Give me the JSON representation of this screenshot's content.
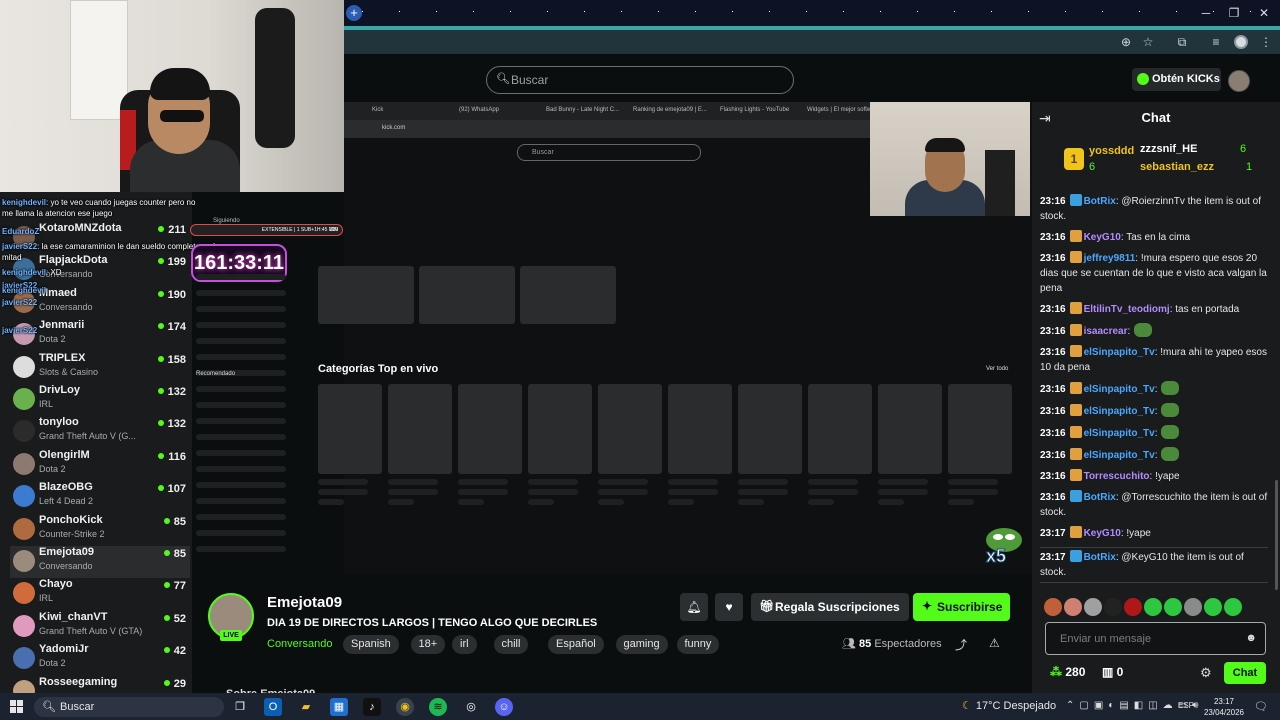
{
  "colors": {
    "accent": "#53fc18",
    "bg": "#0b0e0f",
    "panel": "#191b1c"
  },
  "header": {
    "search_placeholder": "Buscar",
    "kicks_label": "Obtén KICKs"
  },
  "sidebar": {
    "items": [
      {
        "name": "KotaroMNZdota",
        "sub": "",
        "viewers": "211"
      },
      {
        "name": "FlapjackDota",
        "sub": "Conversando",
        "viewers": "199"
      },
      {
        "name": "Mmaed",
        "sub": "Conversando",
        "viewers": "190"
      },
      {
        "name": "Jenmarii",
        "sub": "Dota 2",
        "viewers": "174"
      },
      {
        "name": "TRIPLEX",
        "sub": "Slots & Casino",
        "viewers": "158"
      },
      {
        "name": "DrivLoy",
        "sub": "IRL",
        "viewers": "132"
      },
      {
        "name": "tonyloo",
        "sub": "Grand Theft Auto V (G...",
        "viewers": "132"
      },
      {
        "name": "OlengirlM",
        "sub": "Dota 2",
        "viewers": "116"
      },
      {
        "name": "BlazeOBG",
        "sub": "Left 4 Dead 2",
        "viewers": "107"
      },
      {
        "name": "PonchoKick",
        "sub": "Counter-Strike 2",
        "viewers": "85"
      },
      {
        "name": "Emejota09",
        "sub": "Conversando",
        "viewers": "85"
      },
      {
        "name": "Chayo",
        "sub": "IRL",
        "viewers": "77"
      },
      {
        "name": "Kiwi_chanVT",
        "sub": "Grand Theft Auto V (GTA)",
        "viewers": "52"
      },
      {
        "name": "YadomiJr",
        "sub": "Dota 2",
        "viewers": "42"
      },
      {
        "name": "Rosseegaming",
        "sub": "",
        "viewers": "29"
      }
    ]
  },
  "overlay_chat": [
    {
      "user": "kenighdevil",
      "text": ": yo te veo cuando juegas counter pero no"
    },
    {
      "user": "",
      "text": "me llama la atencion ese juego"
    },
    {
      "user": "EduardoZ",
      "text": ""
    },
    {
      "user": "javierS22",
      "text": ": la ese camaraminion le dan sueldo completo pa la"
    },
    {
      "user": "",
      "text": "mitad"
    },
    {
      "user": "kenighdevil",
      "text": ": XD"
    },
    {
      "user": "javierS22",
      "text": ""
    },
    {
      "user": "kenighdevil",
      "text": ""
    },
    {
      "user": "javierS22",
      "text": ""
    },
    {
      "user": "javierS22",
      "text": ""
    }
  ],
  "inner_browser": {
    "tabs": [
      "Kick",
      "(92) WhatsApp",
      "Bad Bunny - Late Night C...",
      "Ranking de emejota09 | E...",
      "Flashing Lights - YouTube",
      "Widgets | El mejor softwa..."
    ],
    "url": "kick.com",
    "search": "Buscar",
    "siguiendo": "Siguiendo",
    "subbar_label": "EXTENSIBLE | 1 SUB+1H:45 MIN",
    "subbar_value": "230",
    "timer": "161:33:11",
    "recomendado": "Recomendado",
    "categorias": "Categorías Top en vivo",
    "ver_todo": "Ver todo"
  },
  "stream": {
    "name": "Emejota09",
    "live": "LIVE",
    "title": "DIA 19 DE DIRECTOS LARGOS | TENGO ALGO QUE DECIRLES",
    "category": "Conversando",
    "tags": [
      "Spanish",
      "18+",
      "irl",
      "chill",
      "Español",
      "gaming",
      "funny"
    ],
    "gift_label": "Regala Suscripciones",
    "subscribe_label": "Suscribirse",
    "viewers": "85",
    "viewers_label": "Espectadores",
    "about": "Sobre Emejota09"
  },
  "chat": {
    "title": "Chat",
    "top_gifters": [
      {
        "name": "yossddd",
        "count": "6"
      },
      {
        "name": "zzzsnif_HE",
        "count": "6"
      },
      {
        "name": "sebastian_ezz",
        "count": "1"
      }
    ],
    "messages": [
      {
        "time": "23:16",
        "user": "BotRix",
        "color": "#4aa8ff",
        "text": ": @RoierzinnTv the item is out of stock."
      },
      {
        "time": "23:16",
        "user": "KeyG10",
        "color": "#b28cff",
        "text": ": Tas en la cima"
      },
      {
        "time": "23:16",
        "user": "jeffrey9811",
        "color": "#4aa8ff",
        "text": ": !mura espero que esos 20 dias que se cuentan de lo que e visto aca valgan la pena"
      },
      {
        "time": "23:16",
        "user": "EltilinTv_teodiomj",
        "color": "#b28cff",
        "text": ": tas en portada"
      },
      {
        "time": "23:16",
        "user": "isaacrear",
        "color": "#b28cff",
        "text": ":"
      },
      {
        "time": "23:16",
        "user": "elSinpapito_Tv",
        "color": "#4aa8ff",
        "text": ": !mura ahi te yapeo esos 10 da pena"
      },
      {
        "time": "23:16",
        "user": "elSinpapito_Tv",
        "color": "#4aa8ff",
        "text": ":"
      },
      {
        "time": "23:16",
        "user": "elSinpapito_Tv",
        "color": "#4aa8ff",
        "text": ":"
      },
      {
        "time": "23:16",
        "user": "elSinpapito_Tv",
        "color": "#4aa8ff",
        "text": ":"
      },
      {
        "time": "23:16",
        "user": "elSinpapito_Tv",
        "color": "#4aa8ff",
        "text": ":"
      },
      {
        "time": "23:16",
        "user": "Torrescuchito",
        "color": "#b28cff",
        "text": ": !yape"
      },
      {
        "time": "23:16",
        "user": "BotRix",
        "color": "#4aa8ff",
        "text": ": @Torrescuchito the item is out of stock."
      },
      {
        "time": "23:17",
        "user": "KeyG10",
        "color": "#b28cff",
        "text": ": !yape"
      },
      {
        "time": "23:17",
        "user": "BotRix",
        "color": "#4aa8ff",
        "text": ": @KeyG10 the item is out of stock."
      }
    ],
    "input_placeholder": "Enviar un mensaje",
    "points": "280",
    "points2": "0",
    "send_label": "Chat"
  },
  "taskbar": {
    "search": "Buscar",
    "weather": "17°C  Despejado",
    "lang": "ESP",
    "time": "23:17",
    "date": "23/04/2026"
  }
}
